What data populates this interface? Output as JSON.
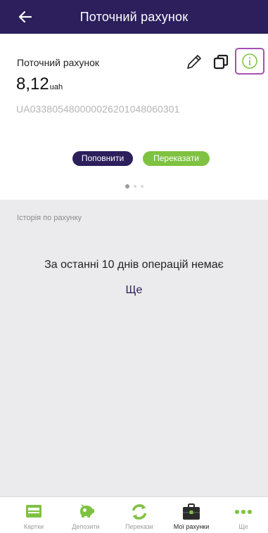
{
  "header": {
    "title": "Поточний рахунок"
  },
  "account": {
    "name": "Поточний рахунок",
    "balance_amount": "8,12",
    "balance_currency": "uah",
    "iban": "UA033805480000026201048060301"
  },
  "actions": {
    "topup_label": "Поповнити",
    "transfer_label": "Переказати"
  },
  "carousel": {
    "pages": 3,
    "active": 0
  },
  "history": {
    "label": "Історія по рахунку",
    "empty_message": "За останні 10 днів операцій немає",
    "more_label": "Ще"
  },
  "bottom_nav": {
    "items": [
      {
        "label": "Картки",
        "icon": "card-icon"
      },
      {
        "label": "Депозити",
        "icon": "piggy-bank-icon"
      },
      {
        "label": "Перекази",
        "icon": "transfer-arrows-icon"
      },
      {
        "label": "Мої рахунки",
        "icon": "briefcase-icon"
      },
      {
        "label": "Ще",
        "icon": "more-dots-icon"
      }
    ],
    "active_index": 3
  },
  "colors": {
    "brand": "#2c1f5c",
    "accent_green": "#7fc241",
    "highlight": "#a74fb3"
  }
}
